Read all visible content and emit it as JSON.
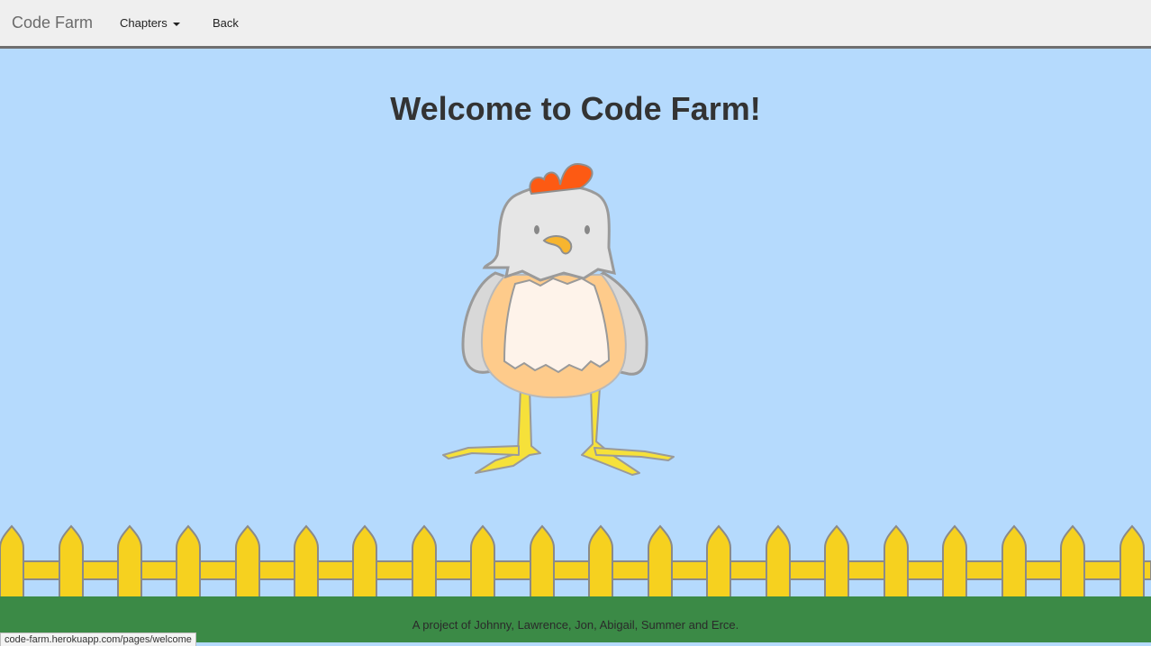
{
  "navbar": {
    "brand": "Code Farm",
    "chapters_label": "Chapters",
    "back_label": "Back"
  },
  "main": {
    "title": "Welcome to Code Farm!"
  },
  "footer": {
    "credits": "A project of Johnny, Lawrence, Jon, Abigail, Summer and Erce."
  },
  "status_bar": {
    "url": "code-farm.herokuapp.com/pages/welcome"
  },
  "colors": {
    "sky": "#b5dafd",
    "navbar": "#efefef",
    "grass": "#3b8a46",
    "fence": "#f6d11f"
  }
}
